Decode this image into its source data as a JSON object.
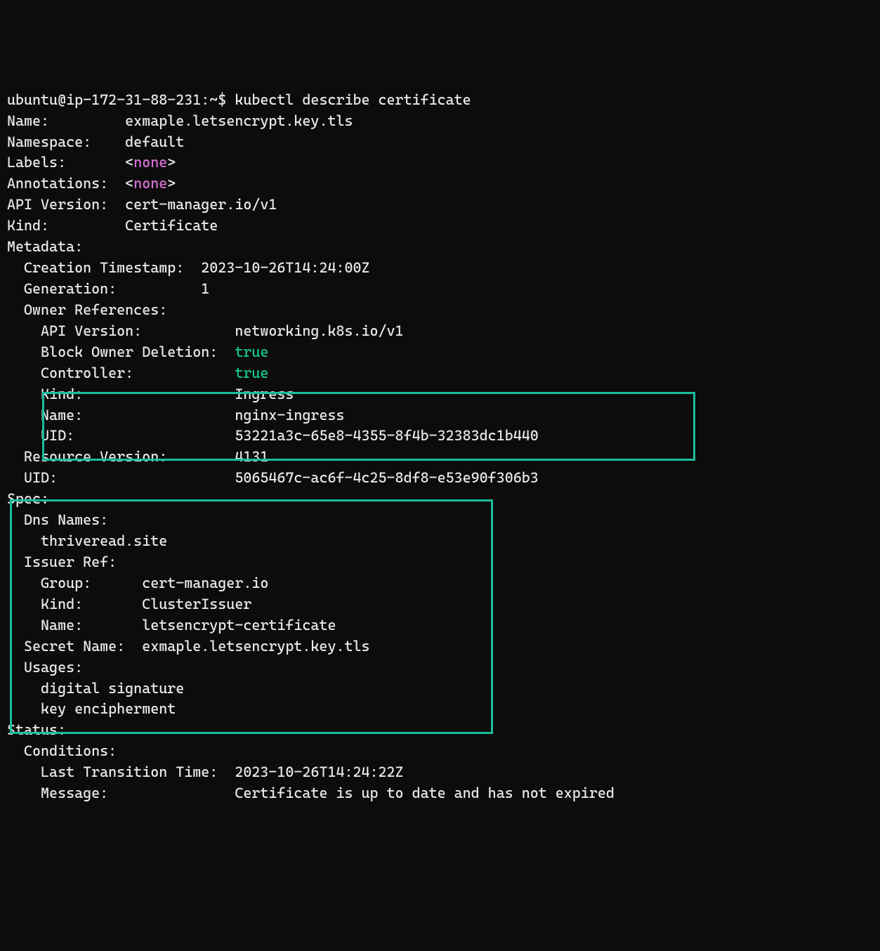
{
  "prompt": {
    "user_host": "ubuntu@ip-172-31-88-231",
    "cwd": ":~$ ",
    "command": "kubectl describe certificate"
  },
  "top": {
    "name_label": "Name:         ",
    "name_value": "exmaple.letsencrypt.key.tls",
    "namespace_label": "Namespace:    ",
    "namespace_value": "default",
    "labels_label": "Labels:       ",
    "labels_lt": "<",
    "labels_none": "none",
    "labels_gt": ">",
    "annotations_label": "Annotations:  ",
    "annotations_lt": "<",
    "annotations_none": "none",
    "annotations_gt": ">",
    "api_label": "API Version:  ",
    "api_value": "cert-manager.io/v1",
    "kind_label": "Kind:         ",
    "kind_value": "Certificate"
  },
  "metadata": {
    "header": "Metadata:",
    "creation_label": "  Creation Timestamp:  ",
    "creation_value": "2023-10-26T14:24:00Z",
    "generation_label": "  Generation:          ",
    "generation_value": "1",
    "owner_header": "  Owner References:",
    "or_api_label": "    API Version:           ",
    "or_api_value": "networking.k8s.io/v1",
    "or_bod_label": "    Block Owner Deletion:  ",
    "or_bod_value": "true",
    "or_ctrl_label": "    Controller:            ",
    "or_ctrl_value": "true",
    "or_kind_label": "    Kind:                  ",
    "or_kind_value": "Ingress",
    "or_name_label": "    Name:                  ",
    "or_name_value": "nginx-ingress",
    "or_uid_label": "    UID:                   ",
    "or_uid_value": "53221a3c-65e8-4355-8f4b-32383dc1b440",
    "rv_label": "  Resource Version:        ",
    "rv_value": "4131",
    "uid_label": "  UID:                     ",
    "uid_value": "5065467c-ac6f-4c25-8df8-e53e90f306b3"
  },
  "spec": {
    "header": "Spec:",
    "dns_header": "  Dns Names:",
    "dns_value": "    thriveread.site",
    "issuer_header": "  Issuer Ref:",
    "group_label": "    Group:      ",
    "group_value": "cert-manager.io",
    "kind_label": "    Kind:       ",
    "kind_value": "ClusterIssuer",
    "name_label": "    Name:       ",
    "name_value": "letsencrypt-certificate",
    "secret_label": "  Secret Name:  ",
    "secret_value": "exmaple.letsencrypt.key.tls",
    "usages_header": "  Usages:",
    "usage1": "    digital signature",
    "usage2": "    key encipherment"
  },
  "status": {
    "header": "Status:",
    "conditions_header": "  Conditions:",
    "ltt_label": "    Last Transition Time:  ",
    "ltt_value": "2023-10-26T14:24:22Z",
    "msg_label": "    Message:               ",
    "msg_value": "Certificate is up to date and has not expired"
  }
}
